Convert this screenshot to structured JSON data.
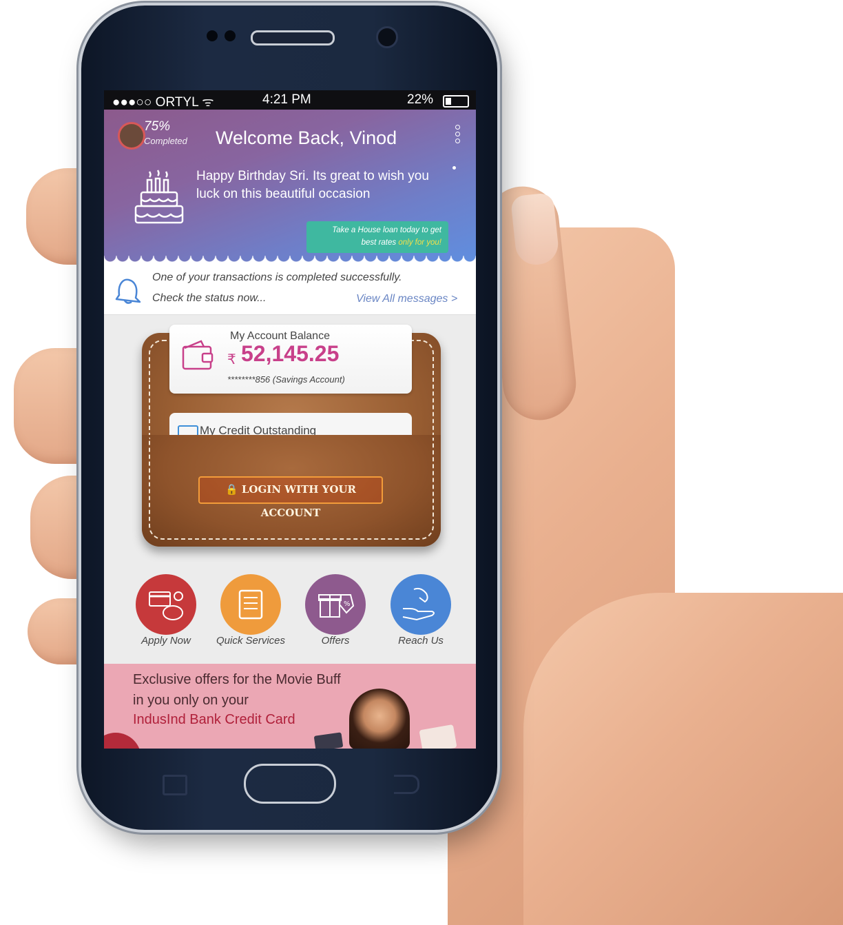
{
  "status_bar": {
    "carrier": "●●●○○ ORTYL ᯤ",
    "time": "4:21 PM",
    "battery": "22%"
  },
  "header": {
    "profile_percent": "75%",
    "profile_status": "Completed",
    "welcome": "Welcome Back, Vinod"
  },
  "birthday": {
    "message": "Happy Birthday Sri. Its great to wish you luck on this beautiful occasion",
    "promo_line1": "Take a House loan today to get",
    "promo_line2_prefix": "best rates ",
    "promo_line2_highlight": "only for you!"
  },
  "notification": {
    "line1": "One of your transactions is completed successfully.",
    "line2": "Check the status now...",
    "link": "View All messages >"
  },
  "account": {
    "title": "My Account Balance",
    "currency": "₹",
    "balance": "52,145.25",
    "account_label": "********856 (Savings Account)"
  },
  "credit": {
    "title": "My Credit Outstanding"
  },
  "login_button": "🔒 LOGIN WITH YOUR ACCOUNT",
  "quick_actions": [
    {
      "label": "Apply Now",
      "color": "#c6393b"
    },
    {
      "label": "Quick Services",
      "color": "#ef9b3c"
    },
    {
      "label": "Offers",
      "color": "#8e5a8e"
    },
    {
      "label": "Reach Us",
      "color": "#4a86d6"
    }
  ],
  "banner": {
    "line1": "Exclusive offers for the Movie Buff",
    "line2": "in you only on your",
    "line3": "IndusInd Bank Credit Card"
  }
}
